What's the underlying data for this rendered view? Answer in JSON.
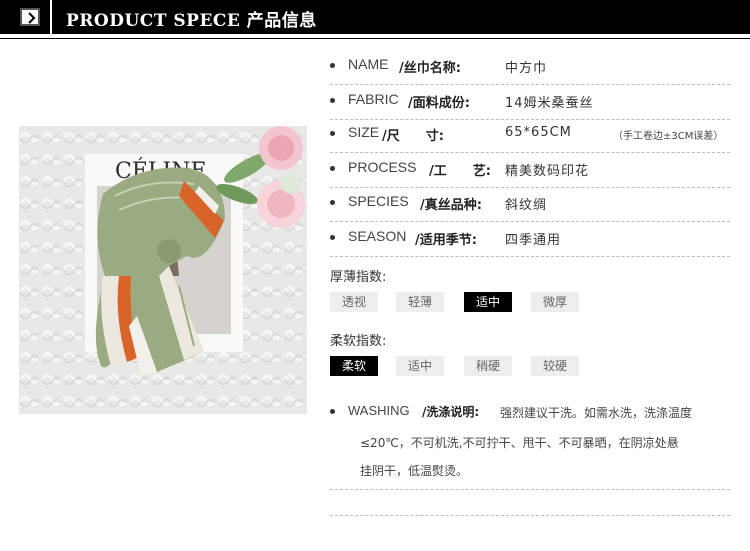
{
  "header": {
    "title": "PRODUCT SPECE 产品信息",
    "icon": "chevron-right-icon"
  },
  "photo": {
    "card_text": "CÉLINE"
  },
  "specs": [
    {
      "en": "NAME",
      "cn": "/丝巾名称:",
      "value": "中方巾"
    },
    {
      "en": "FABRIC",
      "cn": "/面料成份:",
      "value": "14姆米桑蚕丝"
    },
    {
      "en": "SIZE",
      "cn": "/尺　　寸:",
      "value": "65*65CM",
      "note": "（手工卷边±3CM误差）"
    },
    {
      "en": "PROCESS",
      "cn": "/工　　艺:",
      "value": "精美数码印花"
    },
    {
      "en": "SPECIES",
      "cn": "/真丝品种:",
      "value": "斜纹绸"
    },
    {
      "en": "SEASON",
      "cn": "/适用季节:",
      "value": "四季通用"
    }
  ],
  "thickness": {
    "title": "厚薄指数:",
    "options": [
      "透视",
      "轻薄",
      "适中",
      "微厚"
    ],
    "selected": "适中"
  },
  "softness": {
    "title": "柔软指数:",
    "options": [
      "柔软",
      "适中",
      "稍硬",
      "较硬"
    ],
    "selected": "柔软"
  },
  "washing": {
    "en": "WASHING",
    "cn": "/洗涤说明:",
    "line1": "强烈建议干洗。如需水洗，洗涤温度",
    "line2": "≤20℃，不可机洗,不可拧干、甩干、不可暴晒，在阴凉处悬",
    "line3": "挂阴干，低温熨烫。"
  },
  "colors": {
    "header_bg": "#000000",
    "chip_active": "#000000",
    "chip_inactive": "#eeeeee",
    "scarf_green": "#9aab82",
    "scarf_orange": "#d9642a"
  }
}
